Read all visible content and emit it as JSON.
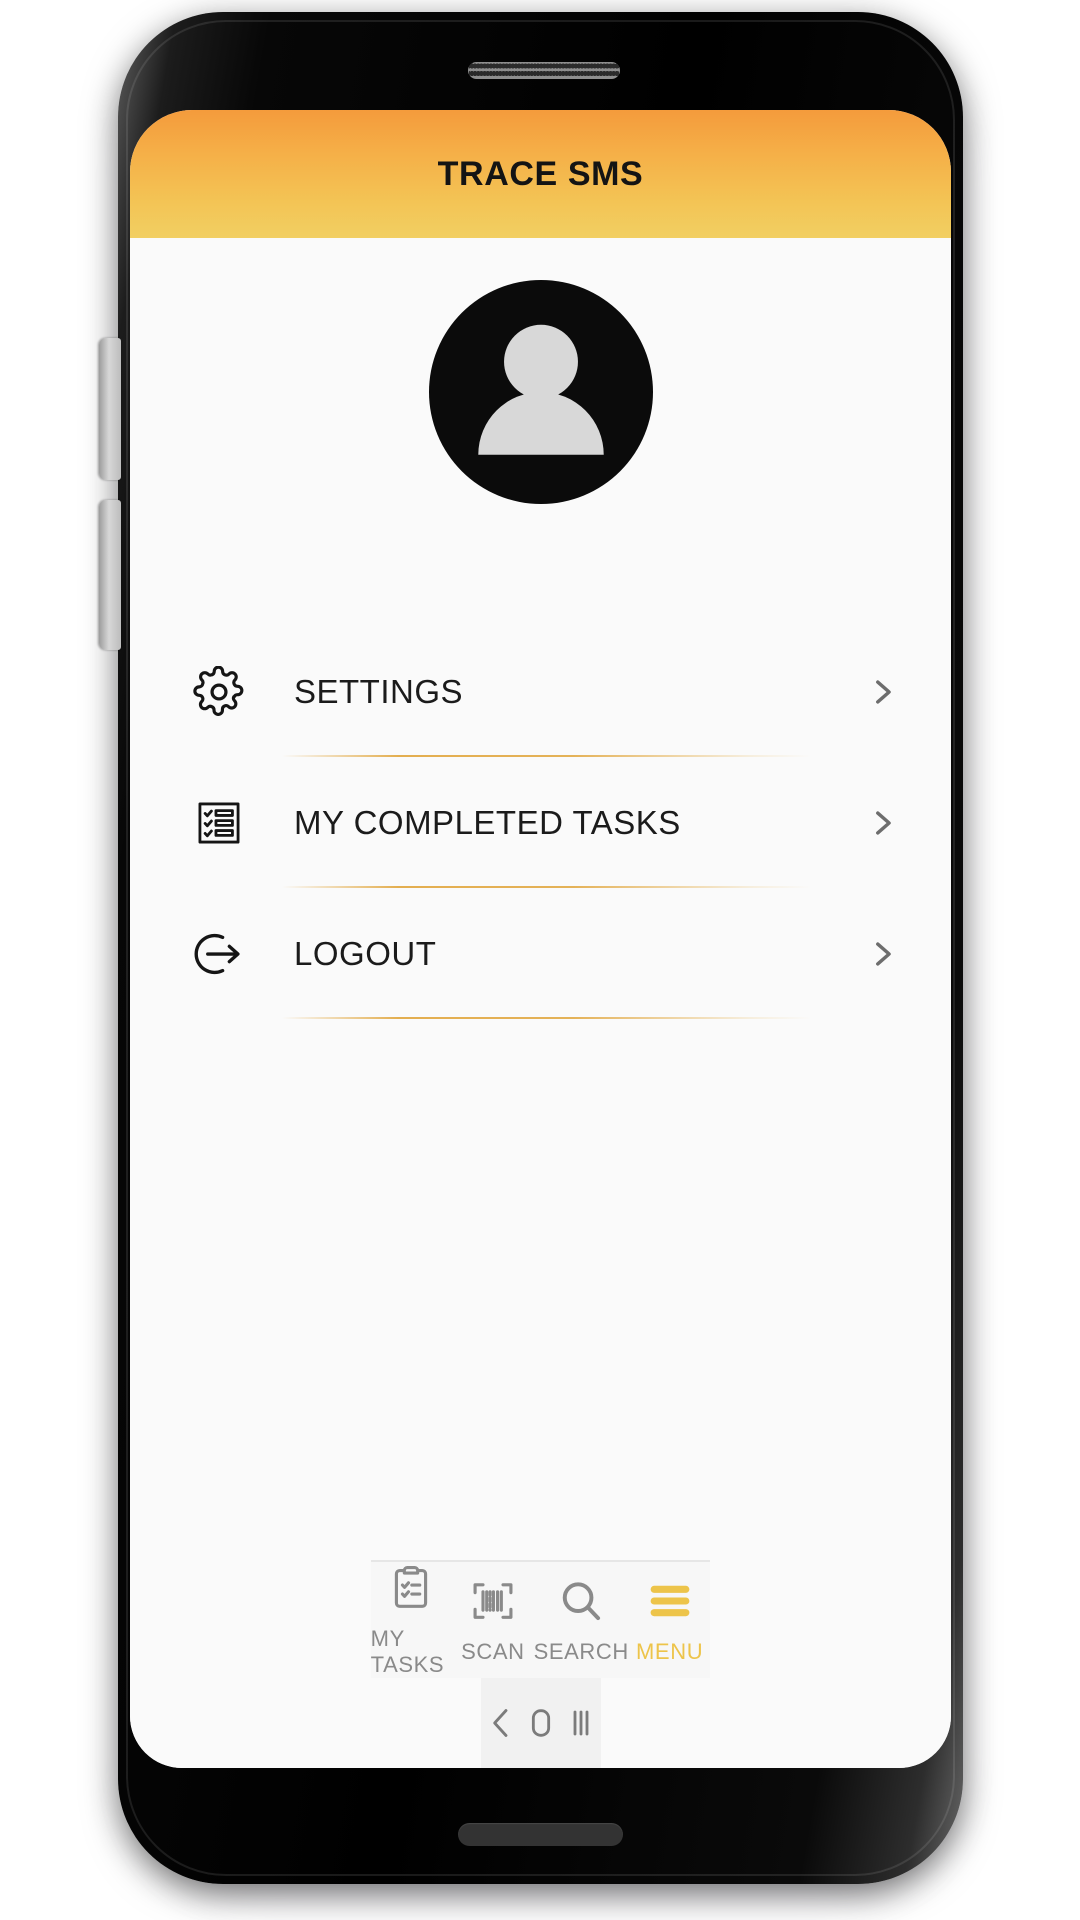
{
  "device": {
    "speaker_grille": "speaker-grille",
    "bottom_speaker": "bottom-speaker-bar",
    "side_buttons": [
      "volume-button",
      "power-button"
    ]
  },
  "header": {
    "title": "TRACE SMS",
    "gradient_from": "#F49B3C",
    "gradient_to": "#F2CF62"
  },
  "profile": {
    "avatar_icon": "person-avatar-icon",
    "avatar_bg": "#0B0B0B",
    "avatar_fg": "#D8D8D8"
  },
  "menu": {
    "divider_color": "#E2AA46",
    "chevron_color": "#6D6D6D",
    "items": [
      {
        "id": "settings",
        "label": "SETTINGS",
        "icon": "gear-icon",
        "chevron": "chevron-right-icon"
      },
      {
        "id": "completed",
        "label": "MY COMPLETED TASKS",
        "icon": "checklist-icon",
        "chevron": "chevron-right-icon"
      },
      {
        "id": "logout",
        "label": "LOGOUT",
        "icon": "logout-icon",
        "chevron": "chevron-right-icon"
      }
    ]
  },
  "tab_bar": {
    "active_color": "#EDC44A",
    "inactive_color": "#8A8A8A",
    "tabs": [
      {
        "id": "my-tasks",
        "label": "MY TASKS",
        "icon": "clipboard-check-icon",
        "active": false
      },
      {
        "id": "scan",
        "label": "SCAN",
        "icon": "barcode-scan-icon",
        "active": false
      },
      {
        "id": "search",
        "label": "SEARCH",
        "icon": "magnifier-icon",
        "active": false
      },
      {
        "id": "menu",
        "label": "MENU",
        "icon": "hamburger-icon",
        "active": true
      }
    ]
  },
  "system_nav": {
    "back": "back-chevron-icon",
    "home": "home-square-icon",
    "recents": "recents-bars-icon"
  }
}
